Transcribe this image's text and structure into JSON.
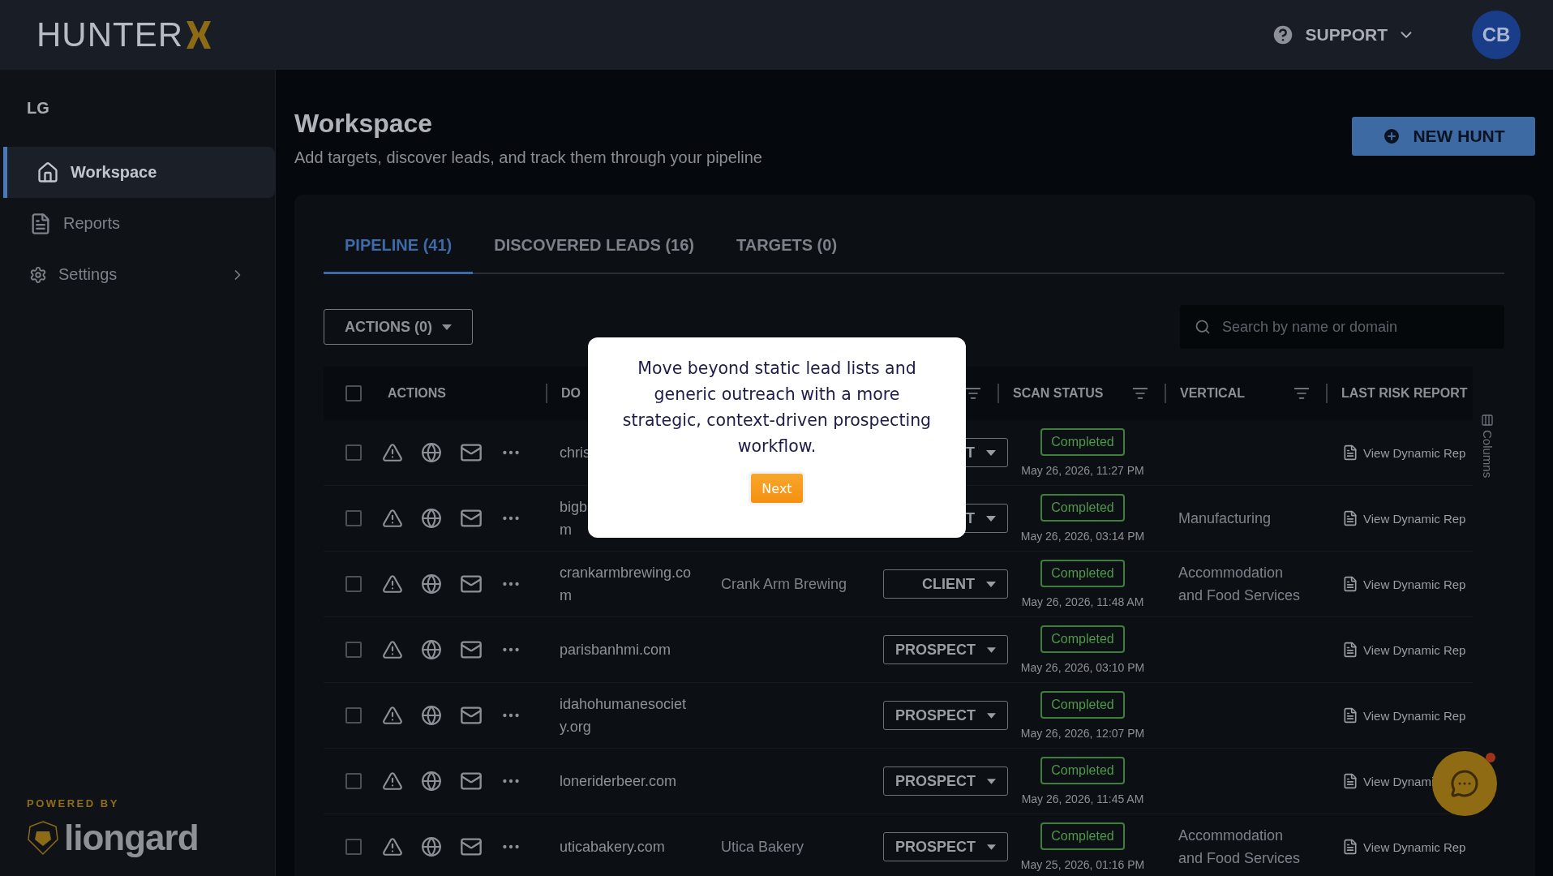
{
  "brand": {
    "name": "HUNTER"
  },
  "header": {
    "support": "SUPPORT",
    "avatar": "CB"
  },
  "sidebar": {
    "org": "LG",
    "items": [
      {
        "label": "Workspace",
        "selected": true,
        "expandable": false
      },
      {
        "label": "Reports",
        "selected": false,
        "expandable": false
      },
      {
        "label": "Settings",
        "selected": false,
        "expandable": true
      }
    ],
    "powered_by": "POWERED BY",
    "partner": "liongard"
  },
  "page": {
    "title": "Workspace",
    "subtitle": "Add targets, discover leads, and track them through your pipeline",
    "new_button": "NEW HUNT"
  },
  "tabs": [
    {
      "label": "PIPELINE (41)",
      "selected": true
    },
    {
      "label": "DISCOVERED LEADS (16)",
      "selected": false
    },
    {
      "label": "TARGETS (0)",
      "selected": false
    }
  ],
  "actions_button": "ACTIONS (0)",
  "search": {
    "placeholder": "Search by name or domain"
  },
  "table": {
    "all_selected": false,
    "columns": [
      {
        "label": "ACTIONS"
      },
      {
        "label": "DO"
      },
      {},
      {
        "filter": true
      },
      {
        "label": "SCAN STATUS",
        "filter": true
      },
      {
        "label": "VERTICAL",
        "filter": true
      },
      {
        "label": "LAST RISK REPORT"
      }
    ],
    "rows": [
      {
        "selected": false,
        "domain": "chris",
        "status": "T",
        "scan_status": "Completed",
        "scan_time": "May 26, 2026, 11:27 PM",
        "report": "View Dynamic Rep"
      },
      {
        "selected": false,
        "domain": "bigb\nm",
        "status": "T",
        "scan_status": "Completed",
        "scan_time": "May 26, 2026, 03:14 PM",
        "vertical": "Manufacturing",
        "report": "View Dynamic Rep"
      },
      {
        "selected": false,
        "domain": "crankarmbrewing.com",
        "company": "Crank Arm Brewing",
        "status": "CLIENT",
        "scan_status": "Completed",
        "scan_time": "May 26, 2026, 11:48 AM",
        "vertical": "Accommodation and Food Services",
        "report": "View Dynamic Rep"
      },
      {
        "selected": false,
        "domain": "parisbanhmi.com",
        "status": "PROSPECT",
        "scan_status": "Completed",
        "scan_time": "May 26, 2026, 03:10 PM",
        "report": "View Dynamic Rep"
      },
      {
        "selected": false,
        "domain": "idahohumanesociety.org",
        "status": "PROSPECT",
        "scan_status": "Completed",
        "scan_time": "May 26, 2026, 12:07 PM",
        "report": "View Dynamic Rep"
      },
      {
        "selected": false,
        "domain": "loneriderbeer.com",
        "status": "PROSPECT",
        "scan_status": "Completed",
        "scan_time": "May 26, 2026, 11:45 AM",
        "report": "View Dynami"
      },
      {
        "selected": false,
        "domain": "uticabakery.com",
        "company": "Utica Bakery",
        "status": "PROSPECT",
        "scan_status": "Completed",
        "scan_time": "May 25, 2026, 01:16 PM",
        "vertical": "Accommodation and Food Services",
        "report": "View Dynamic Rep"
      }
    ]
  },
  "columns_toggle": "Columns",
  "tour": {
    "text": "Move beyond static lead lists and generic outreach with a more strategic, context-driven prospecting workflow.",
    "button": "Next"
  },
  "chat": {
    "unread": true
  }
}
